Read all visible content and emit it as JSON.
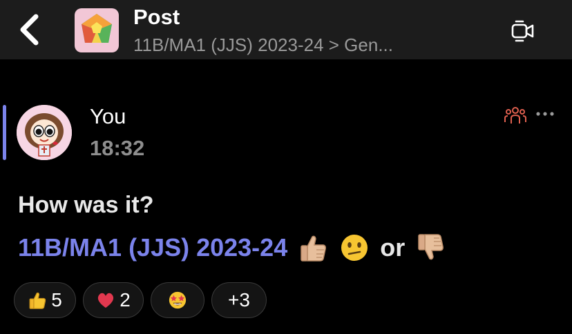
{
  "header": {
    "title": "Post",
    "subtitle": "11B/MA1 (JJS) 2023-24 > Gen..."
  },
  "post": {
    "author": "You",
    "time": "18:32",
    "heading": "How was it?",
    "mention": "11B/MA1 (JJS) 2023-24",
    "connector": "or",
    "body_emojis": [
      "thumbs-up-icon",
      "confused-face-icon",
      "thumbs-down-icon"
    ]
  },
  "reactions": [
    {
      "icon": "thumbs-up-icon",
      "count": "5"
    },
    {
      "icon": "heart-icon",
      "count": "2"
    },
    {
      "icon": "star-struck-icon",
      "count": ""
    },
    {
      "icon": "",
      "count": "+3"
    }
  ],
  "colors": {
    "accent": "#7b83eb",
    "header_bg": "#1c1c1c",
    "team_icon": "#e0604f"
  }
}
